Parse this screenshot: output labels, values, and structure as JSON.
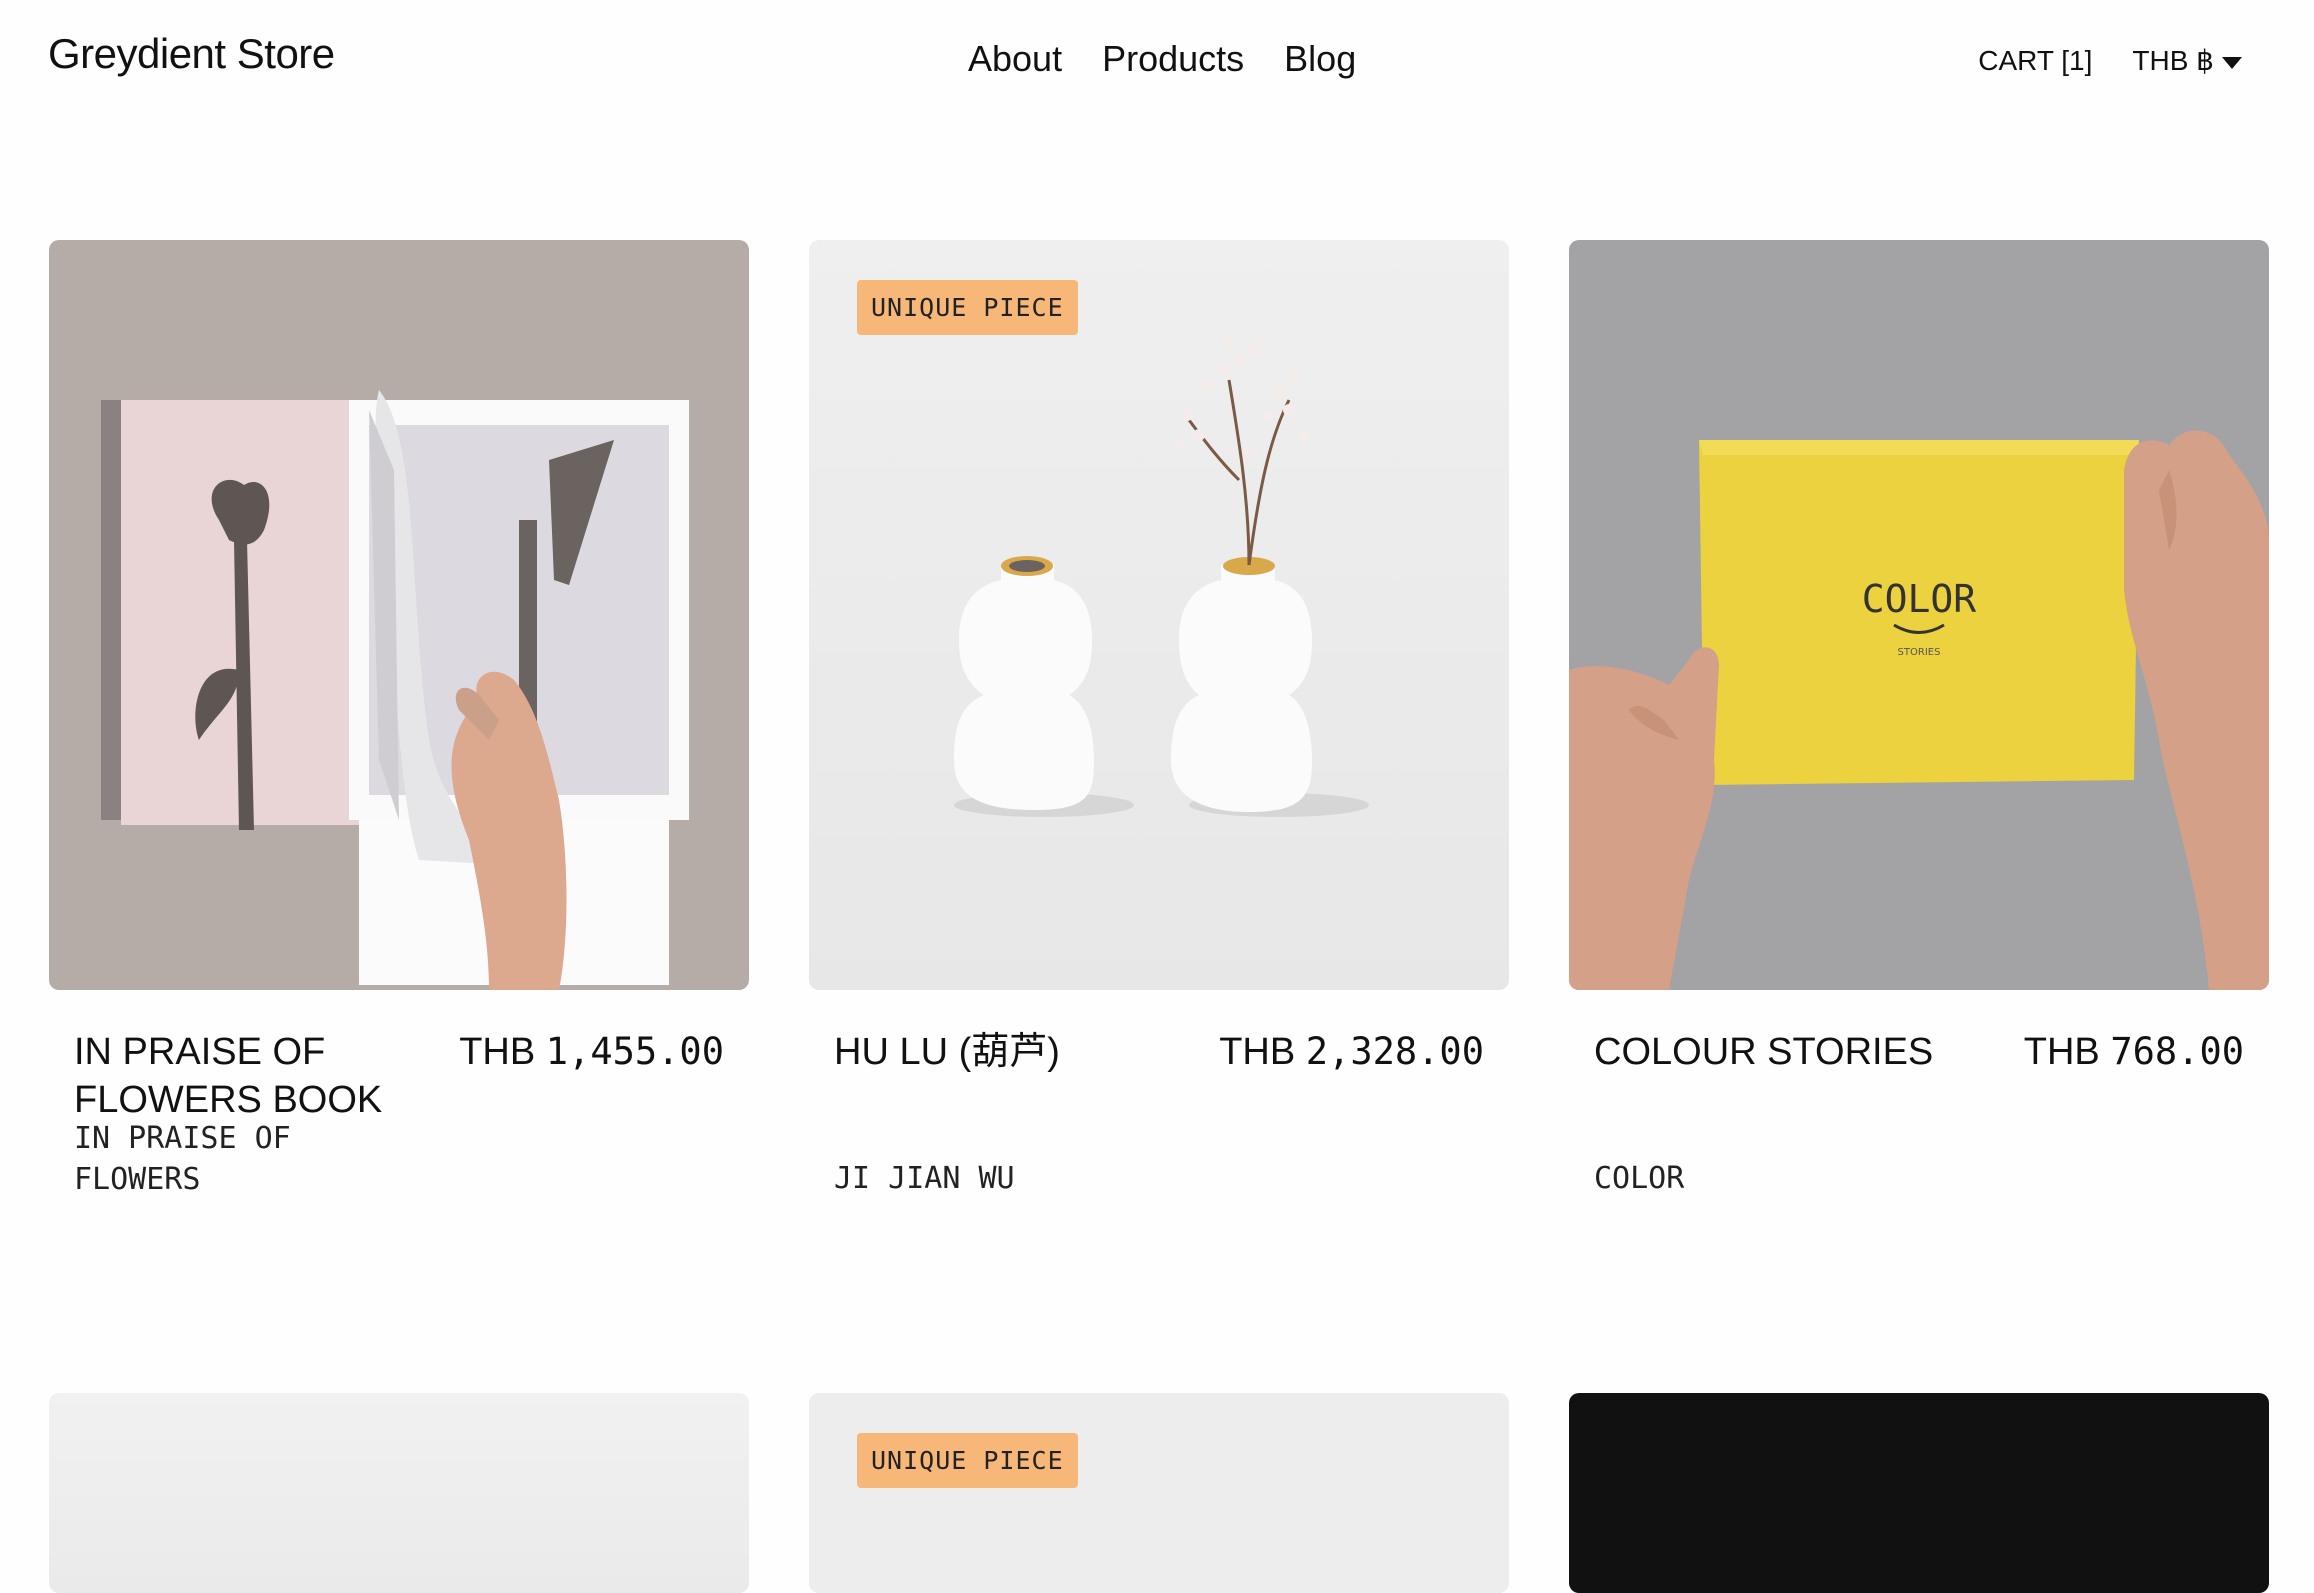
{
  "header": {
    "logo": "Greydient Store",
    "nav": [
      "About",
      "Products",
      "Blog"
    ],
    "cart": "CART [1]",
    "currency": "THB ฿"
  },
  "products": [
    {
      "title": "IN PRAISE OF FLOWERS BOOK",
      "price_currency": "THB",
      "price_value": "1,455.00",
      "vendor": "IN PRAISE OF FLOWERS",
      "badge": ""
    },
    {
      "title": "HU LU (葫芦)",
      "price_currency": "THB",
      "price_value": "2,328.00",
      "vendor": "JI JIAN WU",
      "badge": "UNIQUE PIECE"
    },
    {
      "title": "COLOUR STORIES",
      "price_currency": "THB",
      "price_value": "768.00",
      "vendor": "COLOR",
      "badge": "",
      "box_text": "COLOR",
      "box_subtext": "STORIES"
    }
  ],
  "next_row": [
    {
      "badge": ""
    },
    {
      "badge": "UNIQUE PIECE"
    },
    {
      "badge": ""
    }
  ],
  "colors": {
    "badge": "#f7b779",
    "box_yellow": "#ecd23e"
  }
}
